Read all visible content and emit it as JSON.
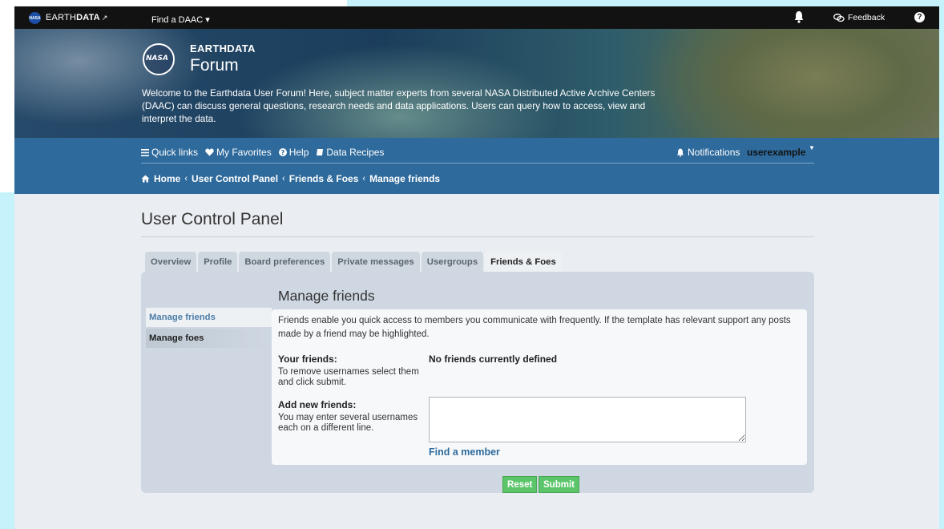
{
  "topbar": {
    "nasa_mini": "NASA",
    "brand_light": "EARTH",
    "brand_bold": "DATA",
    "external_icon": "↗",
    "find_daac": "Find a DAAC ▾",
    "feedback": "Feedback",
    "help": "?"
  },
  "hero": {
    "logo_text": "NASA",
    "title_small": "EARTHDATA",
    "title_large": "Forum",
    "welcome": "Welcome to the Earthdata User Forum! Here, subject matter experts from several NASA Distributed Active Archive Centers (DAAC) can discuss general questions, research needs and data applications. Users can query how to access, view and interpret the data."
  },
  "nav": {
    "quick_links": "Quick links",
    "my_favorites": "My Favorites",
    "help": "Help",
    "data_recipes": "Data Recipes",
    "notifications": "Notifications",
    "username": "userexample",
    "breadcrumb": [
      "Home",
      "User Control Panel",
      "Friends & Foes",
      "Manage friends"
    ]
  },
  "page": {
    "title": "User Control Panel",
    "tabs": [
      "Overview",
      "Profile",
      "Board preferences",
      "Private messages",
      "Usergroups",
      "Friends & Foes"
    ],
    "active_tab": "Friends & Foes",
    "side_menu": [
      "Manage friends",
      "Manage foes"
    ],
    "section_title": "Manage friends",
    "description": "Friends enable you quick access to members you communicate with frequently. If the template has relevant support any posts made by a friend may be highlighted.",
    "your_friends_label": "Your friends:",
    "your_friends_help": "To remove usernames select them and click submit.",
    "no_friends": "No friends currently defined",
    "add_friends_label": "Add new friends:",
    "add_friends_help": "You may enter several usernames each on a different line.",
    "add_friends_value": "",
    "find_member": "Find a member",
    "reset": "Reset",
    "submit": "Submit"
  },
  "colors": {
    "nav_blue": "#2e6a9c",
    "button_green": "#5cc56a",
    "active_side_text": "#4d7ea8"
  }
}
